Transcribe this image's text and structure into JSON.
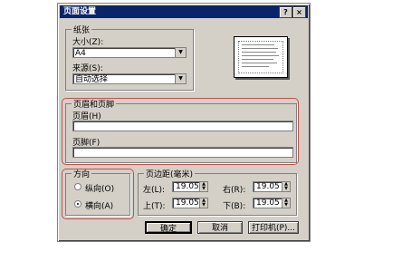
{
  "dialog": {
    "title": "页面设置",
    "help_label": "?",
    "close_label": "×"
  },
  "paper": {
    "group_title": "纸张",
    "size_label": "大小(Z):",
    "size_value": "A4",
    "source_label": "来源(S):",
    "source_value": "自动选择"
  },
  "header_footer": {
    "group_title": "页眉和页脚",
    "header_label": "页眉(H)",
    "header_value": "",
    "footer_label": "页脚(F)",
    "footer_value": ""
  },
  "orientation": {
    "group_title": "方向",
    "portrait_label": "纵向(O)",
    "landscape_label": "横向(A)",
    "selected": "landscape"
  },
  "margins": {
    "group_title": "页边距(毫米)",
    "left_label": "左(L):",
    "left_value": "19.05",
    "right_label": "右(R):",
    "right_value": "19.05",
    "top_label": "上(T):",
    "top_value": "19.05",
    "bottom_label": "下(B):",
    "bottom_value": "19.05"
  },
  "buttons": {
    "ok": "确定",
    "cancel": "取消",
    "printer": "打印机(P)..."
  },
  "colors": {
    "highlight": "#c0504d",
    "titlebar": "#0a246a",
    "dialog_bg": "#d4d0c8"
  }
}
